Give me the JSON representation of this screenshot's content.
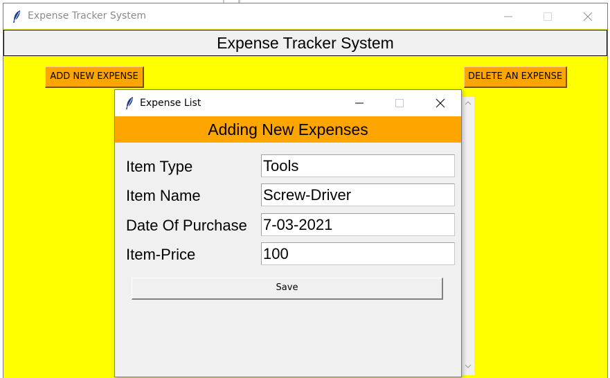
{
  "main_window": {
    "title": "Expense Tracker System",
    "heading": "Expense Tracker System",
    "add_button_label": "ADD NEW EXPENSE",
    "delete_button_label": "DELETE AN EXPENSE",
    "background_color": "#ffff00",
    "button_color": "#ffa500"
  },
  "dialog": {
    "title": "Expense List",
    "header": "Adding New Expenses",
    "header_color": "#ffa500",
    "fields": [
      {
        "label": "Item Type",
        "value": "Tools"
      },
      {
        "label": "Item Name",
        "value": "Screw-Driver"
      },
      {
        "label": "Date Of Purchase",
        "value": "7-03-2021"
      },
      {
        "label": "Item-Price",
        "value": "100"
      }
    ],
    "save_label": "Save"
  },
  "icons": {
    "app": "feather-icon",
    "minimize": "minimize-icon",
    "maximize": "maximize-icon",
    "close": "close-icon"
  }
}
